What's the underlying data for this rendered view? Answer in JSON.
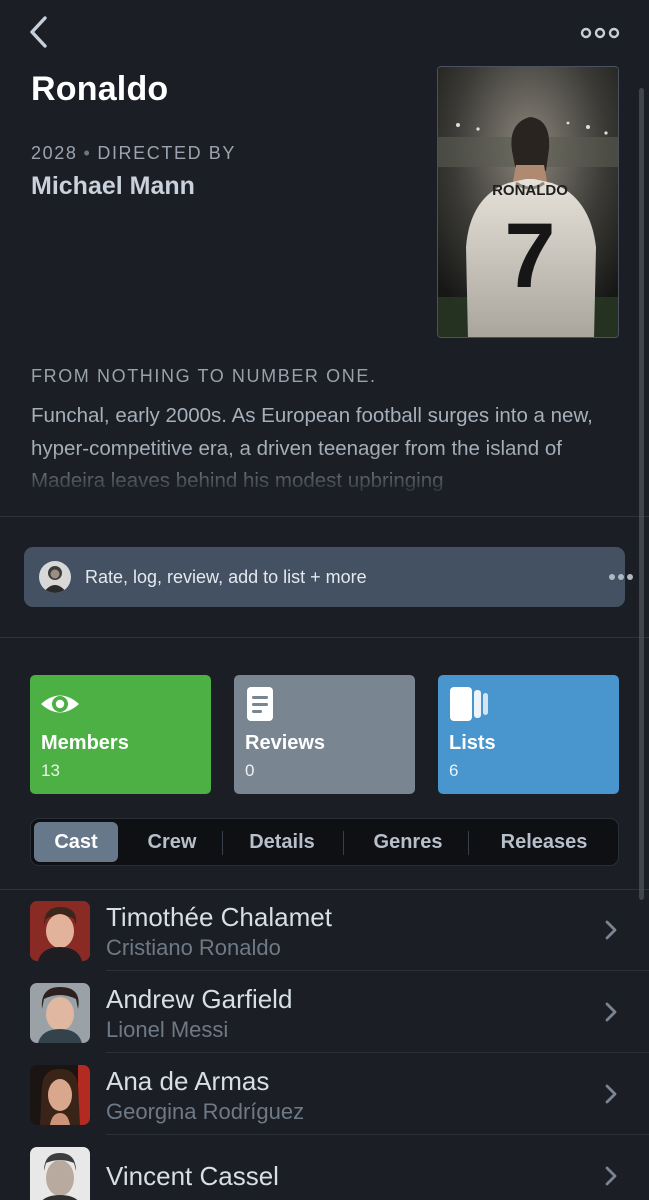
{
  "film": {
    "title": "Ronaldo",
    "year": "2028",
    "directed_by_label": "DIRECTED BY",
    "director": "Michael Mann",
    "poster_text": "RONALDO",
    "poster_number": "7",
    "tagline": "FROM NOTHING TO NUMBER ONE.",
    "synopsis": "Funchal, early 2000s. As European football surges into a new, hyper-competitive era, a driven teenager from the island of Madeira leaves behind his modest upbringing"
  },
  "nav": {
    "back_icon": "chevron-left-icon",
    "more_icon": "more-horizontal-icon"
  },
  "action_bar": {
    "label": "Rate, log, review, add to list + more",
    "more_icon": "more-horizontal-icon"
  },
  "stats": [
    {
      "label": "Members",
      "count": "13",
      "icon": "eye-icon",
      "color": "#4cb045"
    },
    {
      "label": "Reviews",
      "count": "0",
      "icon": "document-icon",
      "color": "#7a8592"
    },
    {
      "label": "Lists",
      "count": "6",
      "icon": "lists-icon",
      "color": "#4896cd"
    }
  ],
  "tabs": [
    {
      "label": "Cast",
      "active": true
    },
    {
      "label": "Crew",
      "active": false
    },
    {
      "label": "Details",
      "active": false
    },
    {
      "label": "Genres",
      "active": false
    },
    {
      "label": "Releases",
      "active": false
    }
  ],
  "cast": [
    {
      "name": "Timothée Chalamet",
      "role": "Cristiano Ronaldo"
    },
    {
      "name": "Andrew Garfield",
      "role": "Lionel Messi"
    },
    {
      "name": "Ana de Armas",
      "role": "Georgina Rodríguez"
    },
    {
      "name": "Vincent Cassel",
      "role": ""
    }
  ],
  "colors": {
    "background": "#1b1e24",
    "action_bar": "#445162",
    "active_tab": "#66788a"
  }
}
